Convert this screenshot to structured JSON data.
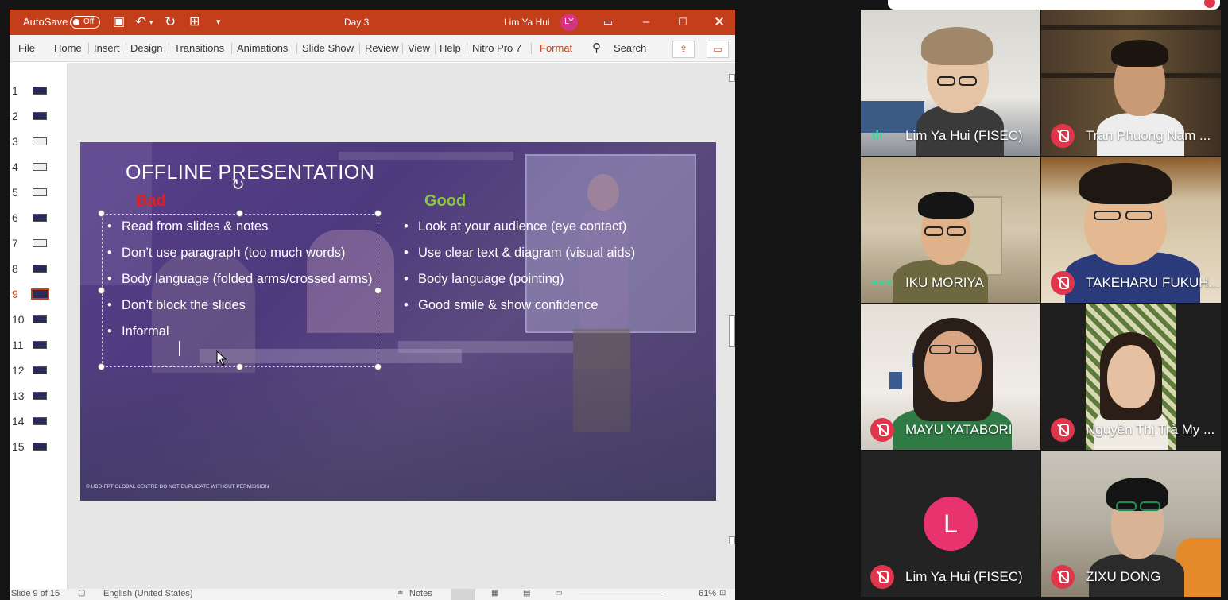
{
  "powerpoint": {
    "autosave_label": "AutoSave",
    "autosave_state": "Off",
    "doc_title": "Day 3",
    "user_name": "Lim Ya Hui",
    "user_initials": "LY",
    "tabs": [
      "File",
      "Home",
      "Insert",
      "Design",
      "Transitions",
      "Animations",
      "Slide Show",
      "Review",
      "View",
      "Help",
      "Nitro Pro 7",
      "Format"
    ],
    "search_label": "Search",
    "thumbnails": [
      "1",
      "2",
      "3",
      "4",
      "5",
      "6",
      "7",
      "8",
      "9",
      "10",
      "11",
      "12",
      "13",
      "14",
      "15"
    ],
    "selected_slide": "9",
    "status": {
      "slide_counter": "Slide 9 of 15",
      "language": "English (United States)",
      "notes": "Notes",
      "zoom": "61%"
    }
  },
  "slide": {
    "title": "OFFLINE PRESENTATION",
    "bad_heading": "Bad",
    "good_heading": "Good",
    "bad_items": [
      "Read from slides & notes",
      "Don’t use paragraph (too much words)",
      "Body language (folded arms/crossed arms)",
      "Don’t block the slides",
      "Informal"
    ],
    "good_items": [
      "Look at your audience (eye contact)",
      "Use clear text & diagram (visual aids)",
      "Body language (pointing)",
      "Good smile & show confidence"
    ],
    "copyright": "© UBD-FPT GLOBAL CENTRE DO NOT DUPLICATE WITHOUT PERMISSION",
    "colors": {
      "bad": "#e02020",
      "good": "#8cc63f"
    }
  },
  "zoom": {
    "participants": [
      {
        "name": "Lim Ya Hui (FISEC)",
        "status": "talking"
      },
      {
        "name": "Tran Phuong Nam ...",
        "status": "muted"
      },
      {
        "name": "IKU MORIYA",
        "status": "unmuted"
      },
      {
        "name": "TAKEHARU FUKUH...",
        "status": "muted"
      },
      {
        "name": "MAYU YATABORI",
        "status": "muted"
      },
      {
        "name": "Nguyễn Thị Trà My ...",
        "status": "muted"
      },
      {
        "name": "Lim Ya Hui (FISEC)",
        "status": "muted",
        "avatar_letter": "L"
      },
      {
        "name": "ZIXU DONG",
        "status": "muted"
      }
    ],
    "colors": {
      "muted": "#e0364b",
      "talking": "#37d49c",
      "avatar": "#e8336e"
    }
  }
}
